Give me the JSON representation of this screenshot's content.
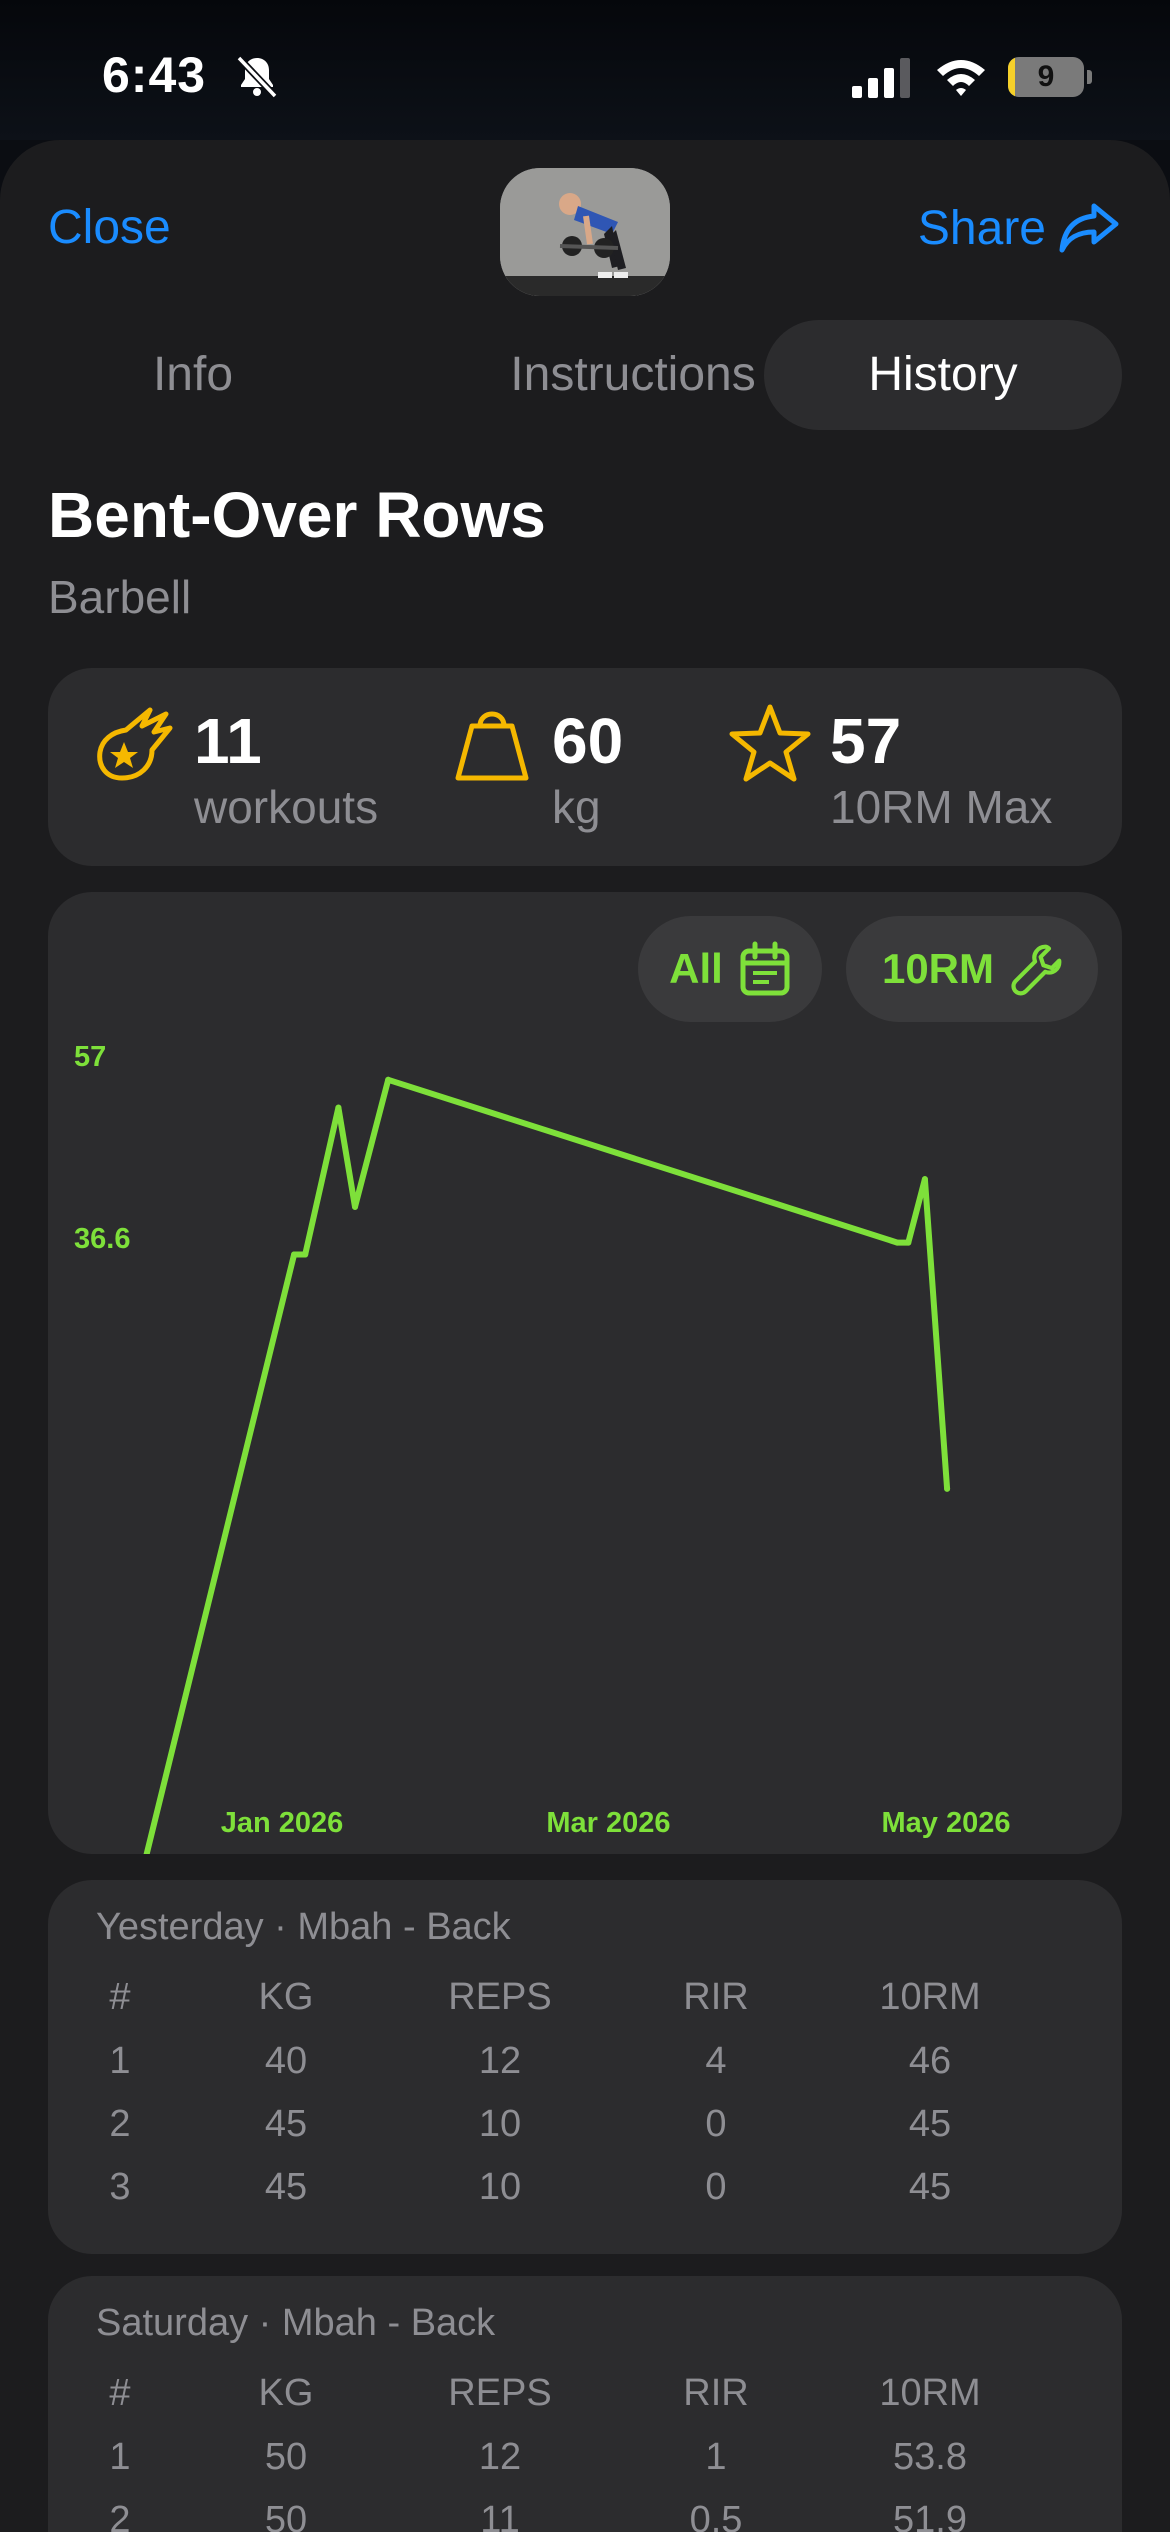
{
  "status": {
    "time": "6:43",
    "battery": "9",
    "battery_fraction": 0.09
  },
  "nav": {
    "close_label": "Close",
    "share_label": "Share"
  },
  "tabs": [
    {
      "label": "Info",
      "active": false
    },
    {
      "label": "Instructions",
      "active": false
    },
    {
      "label": "History",
      "active": true
    }
  ],
  "exercise": {
    "name": "Bent-Over Rows",
    "equipment": "Barbell"
  },
  "stats": [
    {
      "icon": "meteor-star-icon",
      "value": "11",
      "label": "workouts"
    },
    {
      "icon": "weight-icon",
      "value": "60",
      "label": "kg"
    },
    {
      "icon": "star-icon",
      "value": "57",
      "label": "10RM Max"
    }
  ],
  "chart_controls": {
    "range_label": "All",
    "metric_label": "10RM"
  },
  "colors": {
    "accent": "#7ee03a",
    "link": "#1a8cff",
    "stat_icon": "#f5b800"
  },
  "chart_data": {
    "type": "line",
    "title": "",
    "xlabel": "",
    "ylabel": "",
    "ylim": [
      36.6,
      57
    ],
    "y_tick_labels": [
      "57",
      "36.6"
    ],
    "x_tick_labels": [
      "Jan 2026",
      "Mar 2026",
      "May 2026"
    ],
    "x_tick_dates": [
      "2026-01-01",
      "2026-03-01",
      "2026-05-01"
    ],
    "grid": false,
    "series": [
      {
        "x": [
          "2025-12-09",
          "2026-01-05",
          "2026-01-07",
          "2026-01-13",
          "2026-01-16",
          "2026-01-22",
          "2026-04-24",
          "2026-04-26",
          "2026-04-29",
          "2026-05-03"
        ],
        "values": [
          36.6,
          51.9,
          51.9,
          55.6,
          53.1,
          56.3,
          52.2,
          52.2,
          53.8,
          46
        ]
      }
    ]
  },
  "sessions": [
    {
      "header": "Yesterday · Mbah - Back",
      "columns": [
        "#",
        "KG",
        "REPS",
        "RIR",
        "10RM"
      ],
      "rows": [
        [
          "1",
          "40",
          "12",
          "4",
          "46"
        ],
        [
          "2",
          "45",
          "10",
          "0",
          "45"
        ],
        [
          "3",
          "45",
          "10",
          "0",
          "45"
        ]
      ]
    },
    {
      "header": "Saturday · Mbah - Back",
      "columns": [
        "#",
        "KG",
        "REPS",
        "RIR",
        "10RM"
      ],
      "rows": [
        [
          "1",
          "50",
          "12",
          "1",
          "53.8"
        ],
        [
          "2",
          "50",
          "11",
          "0.5",
          "51.9"
        ]
      ]
    }
  ]
}
